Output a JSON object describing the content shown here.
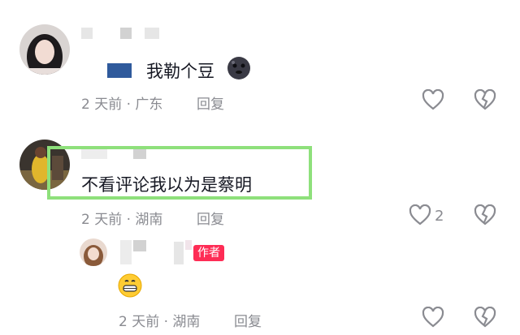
{
  "comments": [
    {
      "text": "我勒个豆",
      "emoji": "dark-face-emoji",
      "time_location": "2 天前 · 广东",
      "reply_label": "回复"
    },
    {
      "text": "不看评论我以为是蔡明",
      "time_location": "2 天前 · 湖南",
      "reply_label": "回复",
      "like_count": "2",
      "highlight_color": "#8ee07b"
    }
  ],
  "reply": {
    "author_badge": "作者",
    "emoji": "grinning-face-emoji",
    "time_location": "2 天前 · 湖南",
    "reply_label": "回复",
    "badge_color": "#fe2c55"
  }
}
